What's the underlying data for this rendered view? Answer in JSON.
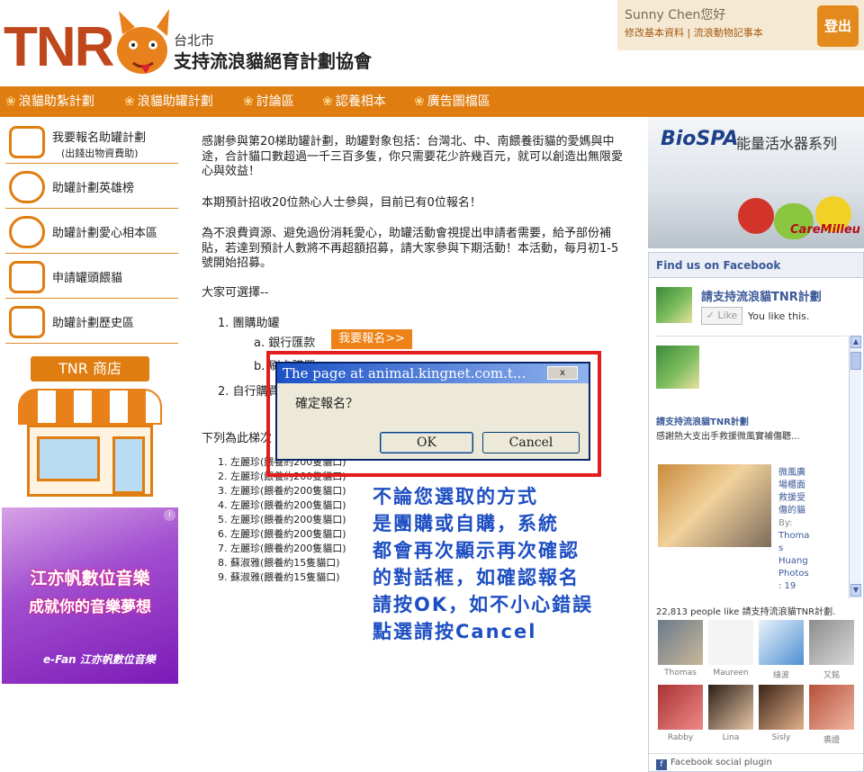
{
  "header": {
    "logo_text": "TNR",
    "assoc_small": "台北市",
    "assoc_big": "支持流浪貓絕育計劃協會",
    "user_greeting": "Sunny Chen您好",
    "user_link_profile": "修改基本資料",
    "user_link_sep": " | ",
    "user_link_diary": "流浪動物記事本",
    "logout_label": "登出"
  },
  "nav": {
    "items": [
      "浪貓助紮計劃",
      "浪貓助罐計劃",
      "討論區",
      "認養相本",
      "廣告圖檔區"
    ]
  },
  "sidebar": {
    "items": [
      {
        "label": "我要報名助罐計劃",
        "sub": "(出錢出物資費助)"
      },
      {
        "label": "助罐計劃英雄榜"
      },
      {
        "label": "助罐計劃愛心相本區"
      },
      {
        "label": "申請罐頭餵貓"
      },
      {
        "label": "助罐計劃歷史區"
      }
    ],
    "shop_sign": "TNR 商店"
  },
  "ad": {
    "line1": "江亦帆數位音樂",
    "line2": "成就你的音樂夢想",
    "brand": "e-Fan 江亦帆數位音樂",
    "info_icon": "i"
  },
  "main": {
    "intro": "感謝參與第20梯助罐計劃，助罐對象包括：台灣北、中、南餵養街貓的愛媽與中途，合計貓口數超過一千三百多隻，你只需要花少許幾百元，就可以創造出無限愛心與效益！",
    "quota": "本期預計招收20位熱心人士參與，目前已有0位報名！",
    "policy": "為不浪費資源、避免過份消耗愛心，助罐活動會視提出申請者需要，給予部份補貼，若達到預計人數將不再超額招募，請大家參與下期活動！本活動，每月初1-5號開始招募。",
    "choose": "大家可選擇--",
    "opt1": "1.  團購助罐",
    "opt1a": "a.  銀行匯款",
    "signup_btn": "我要報名>>",
    "opt1b": "b.  刷卡購買",
    "opt2": "2.  自行購買",
    "list_intro": "下列為此梯次",
    "list": [
      "1.  左麗珍(餵養約200隻貓口)",
      "2.  左麗珍(餵養約200隻貓口)",
      "3.  左麗珍(餵養約200隻貓口)",
      "4.  左麗珍(餵養約200隻貓口)",
      "5.  左麗珍(餵養約200隻貓口)",
      "6.  左麗珍(餵養約200隻貓口)",
      "7.  左麗珍(餵養約200隻貓口)",
      "8.  蘇淑雅(餵養約15隻貓口)",
      "9.  蘇淑雅(餵養約15隻貓口)"
    ]
  },
  "dialog": {
    "title": "The page at animal.kingnet.com.t...",
    "close": "x",
    "message": "確定報名？",
    "ok": "OK",
    "cancel": "Cancel"
  },
  "annotation": {
    "lines": [
      "不論您選取的方式",
      "是團購或自購，系統",
      "都會再次顯示再次確認",
      "的對話框，如確認報名",
      "請按OK，如不小心錯誤",
      "點選請按Cancel"
    ]
  },
  "biospa": {
    "logo": "BioSPA",
    "tagline": "能量活水器系列",
    "care": "CareMilleu"
  },
  "facebook": {
    "header": "Find us on Facebook",
    "page_name": "請支持流浪貓TNR計劃",
    "like_btn": "✓ Like",
    "you_like": "You like this.",
    "stream_title": "請支持流浪貓TNR計劃",
    "stream_text": "感謝熱大支出手救援微風實補傷聽...",
    "photo_caption_lines": [
      "微風廣",
      "場櫃面",
      "救援受",
      "傷的貓"
    ],
    "photo_by_lines": [
      "By:",
      "Thoma",
      "s",
      "Huang",
      "Photos",
      ": 19"
    ],
    "fan_count": "22,813 people like 請支持流浪貓TNR計劃.",
    "fans": [
      "Thomas",
      "Maureen",
      "綠波",
      "又銘",
      "Rabby",
      "Lina",
      "Sisly",
      "裘證"
    ],
    "plugin": "Facebook social plugin",
    "plugin_icon": "f"
  }
}
